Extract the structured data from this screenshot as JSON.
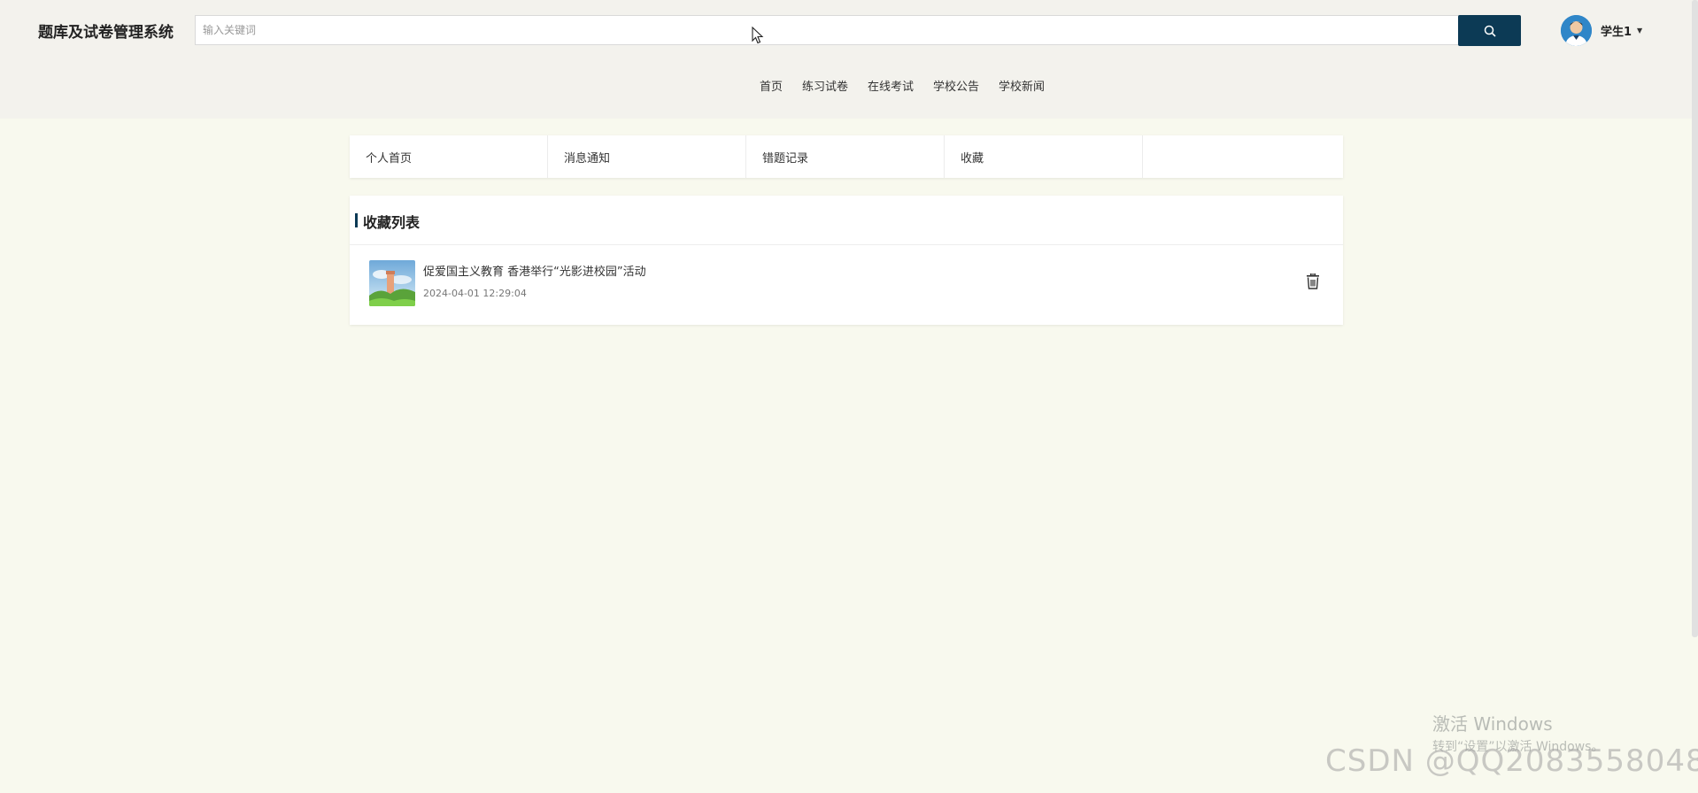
{
  "app": {
    "title": "题库及试卷管理系统"
  },
  "search": {
    "placeholder": "输入关键词",
    "value": "",
    "button_icon": "search-icon"
  },
  "user": {
    "name": "学生1",
    "avatar_icon": "avatar"
  },
  "nav": {
    "items": [
      "首页",
      "练习试卷",
      "在线考试",
      "学校公告",
      "学校新闻"
    ]
  },
  "tabs": {
    "items": [
      "个人首页",
      "消息通知",
      "错题记录",
      "收藏",
      ""
    ]
  },
  "favorites": {
    "title": "收藏列表",
    "items": [
      {
        "title": "促爱国主义教育 香港举行“光影进校园”活动",
        "time": "2024-04-01 12:29:04"
      }
    ]
  },
  "watermarks": {
    "windows_line1": "激活 Windows",
    "windows_line2": "转到“设置”以激活 Windows。",
    "csdn": "CSDN @QQ2083558048"
  },
  "colors": {
    "accent": "#0c3a55",
    "header_bg": "#f3f2ed",
    "page_bg": "#f8f9ee"
  }
}
